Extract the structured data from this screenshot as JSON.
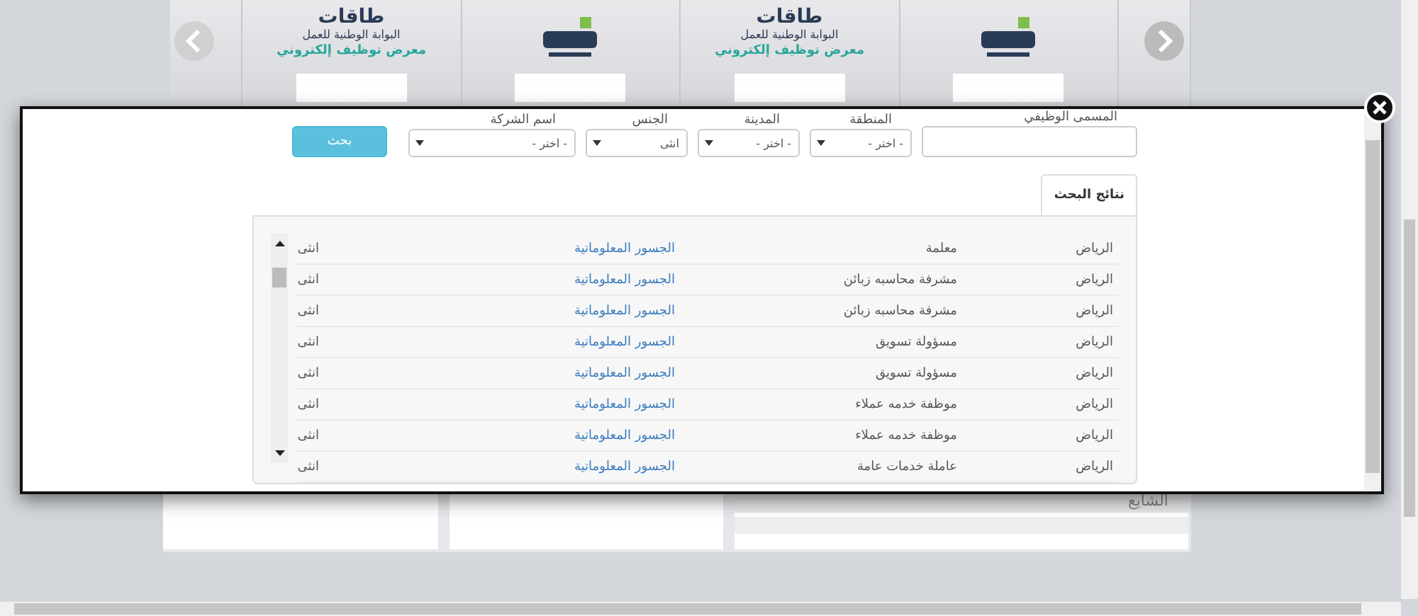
{
  "banner": {
    "slides": [
      {
        "kind": "hadaf"
      },
      {
        "kind": "taqat",
        "title": "طاقات",
        "subtitle": "البوابة الوطنية للعمل",
        "caption": "معرض توظيف إلكتروني"
      },
      {
        "kind": "hadaf"
      },
      {
        "kind": "taqat",
        "title": "طاقات",
        "subtitle": "البوابة الوطنية للعمل",
        "caption": "معرض توظيف إلكتروني"
      }
    ]
  },
  "modal": {
    "filters": [
      {
        "kind": "input",
        "label": "المسمى الوظيفي"
      },
      {
        "kind": "select",
        "label": "المنطقة",
        "value": "- اختر -"
      },
      {
        "kind": "select",
        "label": "المدينة",
        "value": "- اختر -"
      },
      {
        "kind": "select",
        "label": "الجنس",
        "value": "انثى"
      },
      {
        "kind": "select",
        "label": "اسم الشركة",
        "value": "- اختر -"
      }
    ],
    "search_button": "بحث",
    "tabs": [
      {
        "label": "نتائج البحث",
        "selected": true
      }
    ],
    "results": [
      {
        "city": "الرياض",
        "job": "معلمة",
        "company": "الجسور المعلوماتية",
        "gender": "انثى"
      },
      {
        "city": "الرياض",
        "job": "مشرفة محاسبه زبائن",
        "company": "الجسور المعلوماتية",
        "gender": "انثى"
      },
      {
        "city": "الرياض",
        "job": "مشرفة محاسبه زبائن",
        "company": "الجسور المعلوماتية",
        "gender": "انثى"
      },
      {
        "city": "الرياض",
        "job": "مسؤولة تسويق",
        "company": "الجسور المعلوماتية",
        "gender": "انثى"
      },
      {
        "city": "الرياض",
        "job": "مسؤولة تسويق",
        "company": "الجسور المعلوماتية",
        "gender": "انثى"
      },
      {
        "city": "الرياض",
        "job": "موظفة خدمه عملاء",
        "company": "الجسور المعلوماتية",
        "gender": "انثى"
      },
      {
        "city": "الرياض",
        "job": "موظفة خدمه عملاء",
        "company": "الجسور المعلوماتية",
        "gender": "انثى"
      },
      {
        "city": "الرياض",
        "job": "عاملة خدمات عامة",
        "company": "الجسور المعلوماتية",
        "gender": "انثى"
      }
    ]
  },
  "background_list": [
    "الشايع"
  ]
}
